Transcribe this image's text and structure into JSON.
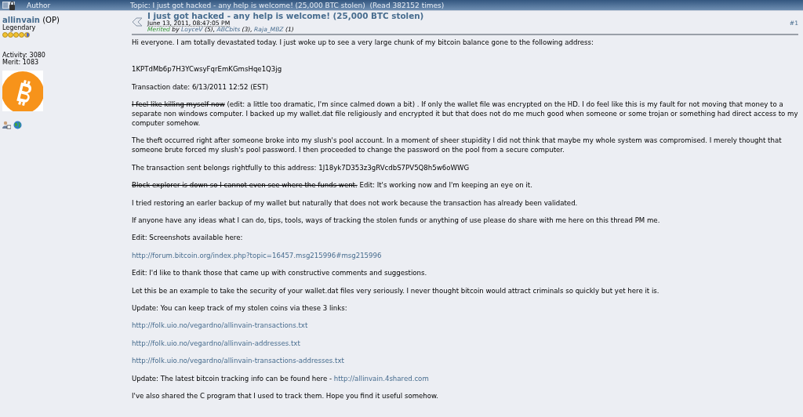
{
  "header": {
    "author_label": "Author",
    "topic": "Topic: I just got hacked - any help is welcome! (25,000 BTC stolen)  (Read 382152 times)"
  },
  "author": {
    "name": "allinvain",
    "role": "(OP)",
    "rank": "Legendary",
    "stars": 4.5,
    "activity": "Activity: 3080",
    "merit": "Merit: 1083"
  },
  "post": {
    "title": "I just got hacked - any help is welcome! (25,000 BTC stolen)",
    "date": "June 13, 2011, 08:47:05 PM",
    "number": "#1",
    "merited": {
      "label": "Merited",
      "by": "by",
      "users": [
        {
          "name": "LoyceV",
          "count": "(5),"
        },
        {
          "name": "ABCbits",
          "count": "(3),"
        },
        {
          "name": "Raja_MBZ",
          "count": "(1)"
        }
      ]
    },
    "paragraphs": [
      [
        {
          "kind": "text",
          "text": "Hi everyone. I am totally devastated today. I just woke up to see a very large chunk of my bitcoin balance gone to the following address:"
        }
      ],
      [
        {
          "kind": "gap"
        }
      ],
      [
        {
          "kind": "text",
          "text": "1KPTdMb6p7H3YCwsyFqrEmKGmsHqe1Q3jg"
        }
      ],
      [
        {
          "kind": "text",
          "text": "Transaction date: 6/13/2011 12:52 (EST)"
        }
      ],
      [
        {
          "kind": "strike",
          "text": "I feel like killing myself now"
        },
        {
          "kind": "text",
          "text": " (edit: a little too dramatic, I'm since calmed down a bit) . If only the wallet file was encrypted on the HD. I do feel like this is my fault for not moving that money to a separate non windows computer. I backed up my wallet.dat file religiously and encrypted it but that does not do me much good when someone or some trojan or something had direct access to my computer somehow."
        }
      ],
      [
        {
          "kind": "text",
          "text": "The theft occurred right after someone broke into my slush's pool account. In a moment of sheer stupidity I did not think that maybe my whole system was compromised. I merely thought that someone brute forced my slush's pool password. I then proceeded to change the password on the pool from a secure computer."
        }
      ],
      [
        {
          "kind": "text",
          "text": "The transaction sent belongs rightfully to this address: 1J18yk7D353z3gRVcdbS7PV5Q8h5w6oWWG"
        }
      ],
      [
        {
          "kind": "strike",
          "text": "Block explorer is down so I cannot even see where the funds went."
        },
        {
          "kind": "text",
          "text": " Edit: It's working now and I'm keeping an eye on it."
        }
      ],
      [
        {
          "kind": "text",
          "text": "I tried restoring an earler backup of my wallet but naturally that does not work because the transaction has already been validated."
        }
      ],
      [
        {
          "kind": "text",
          "text": "If anyone have any ideas what I can do, tips, tools, ways of tracking the stolen funds or anything of use please do share with me here on this thread PM me."
        }
      ],
      [
        {
          "kind": "text",
          "text": "Edit: Screenshots available here:"
        }
      ],
      [
        {
          "kind": "link",
          "text": "http://forum.bitcoin.org/index.php?topic=16457.msg215996#msg215996"
        }
      ],
      [
        {
          "kind": "text",
          "text": "Edit: I'd like to thank those that came up with constructive comments and suggestions."
        }
      ],
      [
        {
          "kind": "text",
          "text": "Let this be an example to take the security of your wallet.dat files very seriously. I never thought bitcoin would attract criminals so quickly but yet here it is."
        }
      ],
      [
        {
          "kind": "text",
          "text": "Update: You can keep track of my stolen coins via these 3 links:"
        }
      ],
      [
        {
          "kind": "link",
          "text": "http://folk.uio.no/vegardno/allinvain-transactions.txt"
        }
      ],
      [
        {
          "kind": "link",
          "text": "http://folk.uio.no/vegardno/allinvain-addresses.txt"
        }
      ],
      [
        {
          "kind": "link",
          "text": "http://folk.uio.no/vegardno/allinvain-transactions-addresses.txt"
        }
      ],
      [
        {
          "kind": "text",
          "text": "Update: The latest bitcoin tracking info can be found here - "
        },
        {
          "kind": "link",
          "text": "http://allinvain.4shared.com"
        }
      ],
      [
        {
          "kind": "text",
          "text": "I've also shared the C program that I used to track them. Hope you find it useful somehow."
        }
      ]
    ]
  }
}
